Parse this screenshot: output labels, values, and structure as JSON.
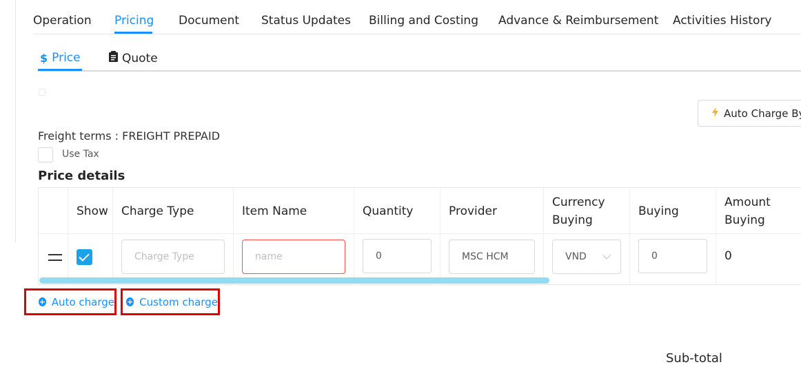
{
  "top_tabs": [
    {
      "label": "Operation"
    },
    {
      "label": "Pricing"
    },
    {
      "label": "Document"
    },
    {
      "label": "Status Updates"
    },
    {
      "label": "Billing and Costing"
    },
    {
      "label": "Advance & Reimbursement"
    },
    {
      "label": "Activities History"
    }
  ],
  "active_top_tab": "Pricing",
  "sub_tabs": [
    {
      "label": "Price",
      "icon": "dollar-icon"
    },
    {
      "label": "Quote",
      "icon": "clipboard-icon"
    }
  ],
  "auto_charge_by": {
    "label": "Auto Charge By",
    "icon": "bolt-icon"
  },
  "freight_terms": "Freight terms : FREIGHT PREPAID",
  "use_tax": {
    "label": "Use Tax",
    "checked": false
  },
  "section_title": "Price details",
  "table": {
    "headers": {
      "show": "Show",
      "charge_type": "Charge Type",
      "item_name": "Item Name",
      "quantity": "Quantity",
      "provider": "Provider",
      "currency_buying": "Currency Buying",
      "buying": "Buying",
      "amount_buying": "Amount Buying"
    },
    "row": {
      "show_checked": true,
      "charge_type_placeholder": "Charge Type",
      "item_name_placeholder": "name",
      "quantity": "0",
      "provider": "MSC HCM",
      "currency_buying": "VND",
      "buying": "0",
      "amount_buying": "0"
    }
  },
  "actions": {
    "auto_charge": "Auto charge",
    "custom_charge": "Custom charge"
  },
  "subtotal_label": "Sub-total",
  "colors": {
    "accent": "#1890ff",
    "checkbox": "#1aa3e8",
    "highlight_border": "#e00000",
    "scrollbar": "#93dbf5"
  }
}
